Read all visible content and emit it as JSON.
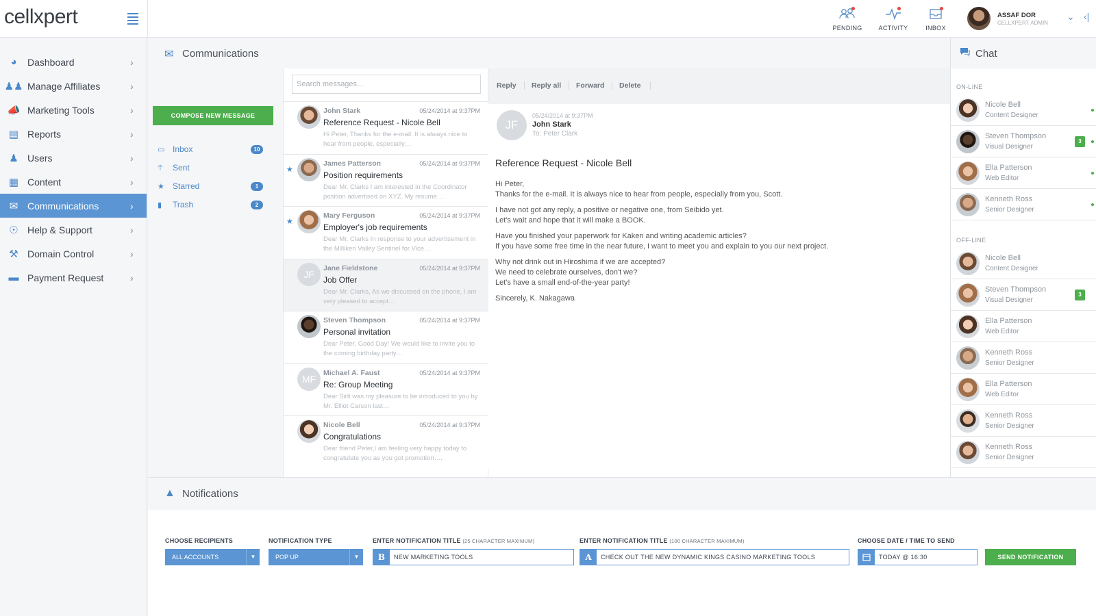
{
  "brand": {
    "logo_text": "cellxpert"
  },
  "top_actions": [
    {
      "label": "PENDING",
      "icon": "pending-users-icon"
    },
    {
      "label": "ACTIVITY",
      "icon": "activity-icon"
    },
    {
      "label": "INBOX",
      "icon": "inbox-icon"
    }
  ],
  "user": {
    "name": "ASSAF DOR",
    "role": "CELLXPERT ADMIN"
  },
  "sidebar": {
    "items": [
      {
        "label": "Dashboard",
        "icon": "dashboard-icon"
      },
      {
        "label": "Manage Affiliates",
        "icon": "affiliates-icon"
      },
      {
        "label": "Marketing Tools",
        "icon": "megaphone-icon"
      },
      {
        "label": "Reports",
        "icon": "reports-icon"
      },
      {
        "label": "Users",
        "icon": "user-icon"
      },
      {
        "label": "Content",
        "icon": "content-icon"
      },
      {
        "label": "Communications",
        "icon": "envelope-icon",
        "active": true
      },
      {
        "label": "Help & Support",
        "icon": "lifebuoy-icon"
      },
      {
        "label": "Domain Control",
        "icon": "wrench-icon"
      },
      {
        "label": "Payment Request",
        "icon": "credit-card-icon"
      }
    ]
  },
  "communications": {
    "title": "Communications",
    "compose_label": "COMPOSE NEW MESSAGE",
    "folders": [
      {
        "label": "Inbox",
        "badge": "10",
        "icon": "inbox-tray-icon"
      },
      {
        "label": "Sent",
        "badge": "",
        "icon": "arrow-up-icon"
      },
      {
        "label": "Starred",
        "badge": "1",
        "icon": "star-icon"
      },
      {
        "label": "Trash",
        "badge": "2",
        "icon": "trash-icon"
      }
    ],
    "search_placeholder": "Search messages...",
    "messages": [
      {
        "from": "John Stark",
        "date": "05/24/2014 at 9:37PM",
        "subject": "Reference Request - Nicole Bell",
        "preview": "Hi Peter, Thanks for the e-mail. It is always nice to hear from people, especially…",
        "starred": false,
        "initials": ""
      },
      {
        "from": "James Patterson",
        "date": "05/24/2014 at 9:37PM",
        "subject": "Position requirements",
        "preview": "Dear Mr. Clarks I am interested in the Coordinator position advertised on XYZ. My resume…",
        "starred": true,
        "initials": ""
      },
      {
        "from": "Mary Ferguson",
        "date": "05/24/2014 at 9:37PM",
        "subject": "Employer's job requirements",
        "preview": "Dear Mr. Clarks In response to your advertisement in the Milliken Valley Sentinel for Vice…",
        "starred": true,
        "initials": ""
      },
      {
        "from": "Jane Fieldstone",
        "date": "05/24/2014 at 9:37PM",
        "subject": "Job Offer",
        "preview": "Dear Mr. Clarks, As we discussed on the phone, I am very pleased to accept…",
        "starred": false,
        "initials": "JF",
        "selected": true
      },
      {
        "from": "Steven Thompson",
        "date": "05/24/2014 at 9:37PM",
        "subject": "Personal invitation",
        "preview": "Dear Peter, Good Day! We would like to invite you to the coming birthday party…",
        "starred": false,
        "initials": ""
      },
      {
        "from": "Michael A. Faust",
        "date": "05/24/2014 at 9:37PM",
        "subject": "Re: Group Meeting",
        "preview": "Dear Sirlt was my pleasure to be introduced to you by Mr. Elliot Carson last…",
        "starred": false,
        "initials": "MF"
      },
      {
        "from": "Nicole Bell",
        "date": "05/24/2014 at 9:37PM",
        "subject": "Congratulations",
        "preview": "Dear friend Peter,I am feeling very happy today to congratulate you as you got promotion….",
        "starred": false,
        "initials": ""
      }
    ],
    "reader": {
      "actions": [
        "Reply",
        "Reply all",
        "Forward",
        "Delete"
      ],
      "avatar_initials": "JF",
      "date": "05/24/2014 at 9:37PM",
      "from": "John Stark",
      "to": "To: Peter Clark",
      "subject": "Reference Request - Nicole Bell",
      "body": [
        "Hi Peter,\nThanks for the e-mail. It is always nice to hear from people, especially from you, Scott.",
        "I have not got any reply, a positive or negative one, from Seibido yet.\nLet's wait and hope that it will make a BOOK.",
        "Have you finished your paperwork for Kaken and writing academic articles?\nIf you have some free time in the near future, I want to meet you and explain to you our next project.",
        "Why not drink out in Hiroshima if we are accepted?\nWe need to celebrate ourselves, don't we?\nLet's have a small end-of-the-year party!",
        "Sincerely, K. Nakagawa"
      ]
    }
  },
  "chat": {
    "title": "Chat",
    "online_label": "ON-LINE",
    "offline_label": "OFF-LINE",
    "online": [
      {
        "name": "Nicole Bell",
        "role": "Content Designer",
        "badge": ""
      },
      {
        "name": "Steven Thompson",
        "role": "Visual Designer",
        "badge": "3"
      },
      {
        "name": "Ella Patterson",
        "role": "Web Editor",
        "badge": ""
      },
      {
        "name": "Kenneth Ross",
        "role": "Senior Designer",
        "badge": ""
      }
    ],
    "offline": [
      {
        "name": "Nicole Bell",
        "role": "Content Designer",
        "badge": ""
      },
      {
        "name": "Steven Thompson",
        "role": "Visual Designer",
        "badge": "3"
      },
      {
        "name": "Ella Patterson",
        "role": "Web Editor",
        "badge": ""
      },
      {
        "name": "Kenneth Ross",
        "role": "Senior Designer",
        "badge": ""
      },
      {
        "name": "Ella Patterson",
        "role": "Web Editor",
        "badge": ""
      },
      {
        "name": "Kenneth Ross",
        "role": "Senior Designer",
        "badge": ""
      },
      {
        "name": "Kenneth Ross",
        "role": "Senior Designer",
        "badge": ""
      }
    ]
  },
  "notifications": {
    "title": "Notifications",
    "recipients_label": "CHOOSE RECIPIENTS",
    "recipients_value": "ALL ACCOUNTS",
    "type_label": "NOTIFICATION TYPE",
    "type_value": "POP UP",
    "title_label": "ENTER NOTIFICATION TITLE",
    "title_hint": "(25 CHARACTER MAXIMUM)",
    "title_value": "NEW MARKETING TOOLS",
    "message_label": "ENTER NOTIFICATION TITLE",
    "message_hint": "(100 CHARACTER MAXIMUM)",
    "message_value": "CHECK OUT THE NEW DYNAMIC KINGS CASINO MARKETING TOOLS",
    "date_label": "CHOOSE DATE / TIME TO SEND",
    "date_value": "TODAY @ 16:30",
    "send_label": "SEND NOTIFICATION",
    "bold_icon_text": "B",
    "text_icon_text": "A"
  },
  "colors": {
    "accent": "#5b95d3",
    "green": "#4cae4c",
    "link": "#4a88c9"
  }
}
